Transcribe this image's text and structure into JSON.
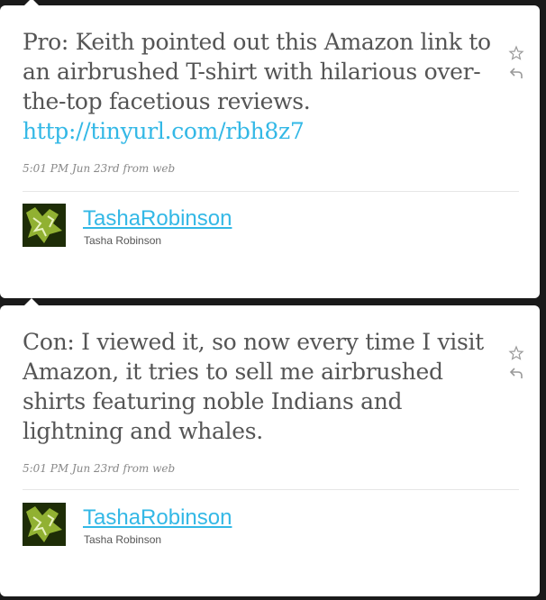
{
  "tweets": [
    {
      "text": "Pro: Keith pointed out this Amazon link to an airbrushed T-shirt with hilarious over-the-top facetious reviews.",
      "link": "http://tinyurl.com/rbh8z7",
      "meta": "5:01 PM Jun 23rd from web",
      "screen_name": "TashaRobinson",
      "full_name": "Tasha Robinson",
      "icons": [
        "star-icon",
        "reply-icon"
      ]
    },
    {
      "text": "Con: I viewed it, so now every time I visit Amazon, it tries to sell me airbrushed shirts featuring noble Indians and lightning and whales.",
      "meta": "5:01 PM Jun 23rd from web",
      "screen_name": "TashaRobinson",
      "full_name": "Tasha Robinson",
      "icons": [
        "star-icon",
        "reply-icon"
      ]
    }
  ],
  "colors": {
    "background": "#1a1a1a",
    "card": "#ffffff",
    "text": "#555555",
    "link": "#33b8e6",
    "meta": "#888888",
    "avatar": "#1e2d07"
  }
}
